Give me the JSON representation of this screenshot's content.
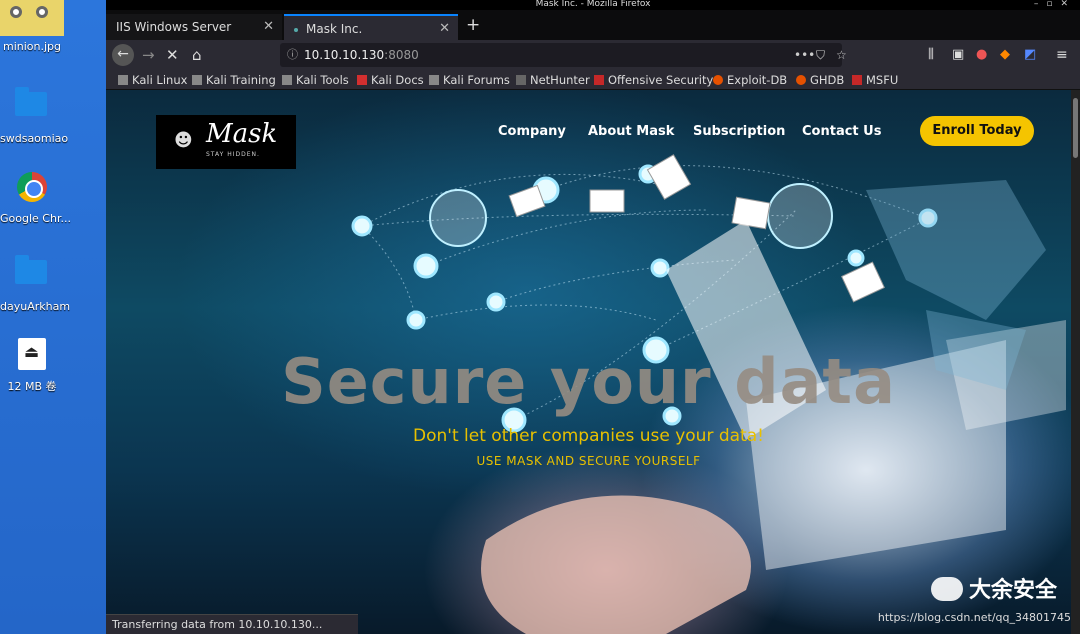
{
  "desktop": {
    "icons": [
      {
        "label": "minion.jpg"
      },
      {
        "label": "swdsaomiao"
      },
      {
        "label": "Google Chr..."
      },
      {
        "label": "dayuArkham"
      },
      {
        "label": "12 MB 卷"
      }
    ]
  },
  "window": {
    "title": "Mask Inc. - Mozilla Firefox"
  },
  "tabs": [
    {
      "label": "IIS Windows Server"
    },
    {
      "label": "Mask Inc."
    }
  ],
  "address": {
    "host": "10.10.10.130",
    "port": ":8080"
  },
  "url_actions": {
    "more": "•••",
    "pocket": "⛉",
    "star": "☆"
  },
  "bookmarks": [
    {
      "label": "Kali Linux",
      "color": "#bbbbbb"
    },
    {
      "label": "Kali Training",
      "color": "#bbbbbb"
    },
    {
      "label": "Kali Tools",
      "color": "#bbbbbb"
    },
    {
      "label": "Kali Docs",
      "color": "#d32f2f"
    },
    {
      "label": "Kali Forums",
      "color": "#bbbbbb"
    },
    {
      "label": "NetHunter",
      "color": "#bbbbbb"
    },
    {
      "label": "Offensive Security",
      "color": "#c62828"
    },
    {
      "label": "Exploit-DB",
      "color": "#e65100"
    },
    {
      "label": "GHDB",
      "color": "#e65100"
    },
    {
      "label": "MSFU",
      "color": "#c62828"
    }
  ],
  "site": {
    "logo_word": "Mask",
    "logo_tag": "STAY HIDDEN.",
    "nav": [
      "Company",
      "About Mask",
      "Subscription",
      "Contact Us"
    ],
    "cta": "Enroll Today",
    "headline": "Secure your data",
    "subhead": "Don't let other companies use your data!",
    "tagline": "USE MASK AND SECURE YOURSELF"
  },
  "status": "Transferring data from 10.10.10.130...",
  "watermark": {
    "brand": "大余安全",
    "url": "https://blog.csdn.net/qq_34801745"
  },
  "colors": {
    "accent": "#f5c400",
    "hero_text": "#e8c000",
    "tab_highlight": "#0a84ff"
  }
}
